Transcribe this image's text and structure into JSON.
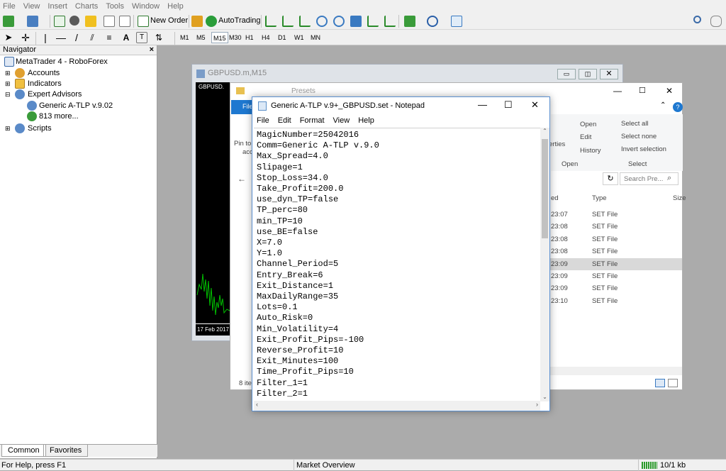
{
  "menu": [
    "File",
    "View",
    "Insert",
    "Charts",
    "Tools",
    "Window",
    "Help"
  ],
  "toolbar": {
    "new_order": "New Order",
    "autotrading": "AutoTrading"
  },
  "timeframes": [
    "M1",
    "M5",
    "M15",
    "M30",
    "H1",
    "H4",
    "D1",
    "W1",
    "MN"
  ],
  "active_timeframe": "M15",
  "navigator": {
    "title": "Navigator",
    "close": "×",
    "items": [
      "MetaTrader 4 - RoboForex",
      "Accounts",
      "Indicators",
      "Expert Advisors",
      "Generic A-TLP v.9.02",
      "813 more...",
      "Scripts"
    ],
    "tabs": [
      "Common",
      "Favorites"
    ]
  },
  "chart": {
    "window_title": "GBPUSD.m,M15",
    "symbol_label": "GBPUSD.",
    "date_label": "17 Feb 2017"
  },
  "explorer": {
    "quick_label": "Presets",
    "file_tab": "File",
    "pin_label": "Pin to",
    "pin_label2": "acc",
    "open_btn": "Open",
    "edit_btn": "Edit",
    "history_btn": "History",
    "properties": "erties",
    "select_all": "Select all",
    "select_none": "Select none",
    "invert": "Invert selection",
    "group_open": "Open",
    "group_select": "Select",
    "search_placeholder": "Search Pre...",
    "col_modified": "ed",
    "col_type": "Type",
    "col_size": "Size",
    "rows": [
      {
        "time": "23:07",
        "type": "SET File"
      },
      {
        "time": "23:08",
        "type": "SET File"
      },
      {
        "time": "23:08",
        "type": "SET File"
      },
      {
        "time": "23:08",
        "type": "SET File"
      },
      {
        "time": "23:09",
        "type": "SET File"
      },
      {
        "time": "23:09",
        "type": "SET File"
      },
      {
        "time": "23:09",
        "type": "SET File"
      },
      {
        "time": "23:10",
        "type": "SET File"
      }
    ],
    "item_count": "8 ite"
  },
  "notepad": {
    "title": "Generic A-TLP v.9+_GBPUSD.set - Notepad",
    "menu": [
      "File",
      "Edit",
      "Format",
      "View",
      "Help"
    ],
    "lines": [
      "MagicNumber=25042016",
      "Comm=Generic A-TLP v.9.0",
      "Max_Spread=4.0",
      "Slipage=1",
      "Stop_Loss=34.0",
      "Take_Profit=200.0",
      "use_dyn_TP=false",
      "TP_perc=80",
      "min_TP=10",
      "use_BE=false",
      "X=7.0",
      "Y=1.0",
      "Channel_Period=5",
      "Entry_Break=6",
      "Exit_Distance=1",
      "MaxDailyRange=35",
      "Lots=0.1",
      "Auto_Risk=0",
      "Min_Volatility=4",
      "Exit_Profit_Pips=-100",
      "Reverse_Profit=10",
      "Exit_Minutes=100",
      "Time_Profit_Pips=10",
      "Filter_1=1",
      "Filter_2=1"
    ]
  },
  "status": {
    "help": "For Help, press F1",
    "profile": "Market Overview",
    "traffic": "10/1 kb"
  }
}
